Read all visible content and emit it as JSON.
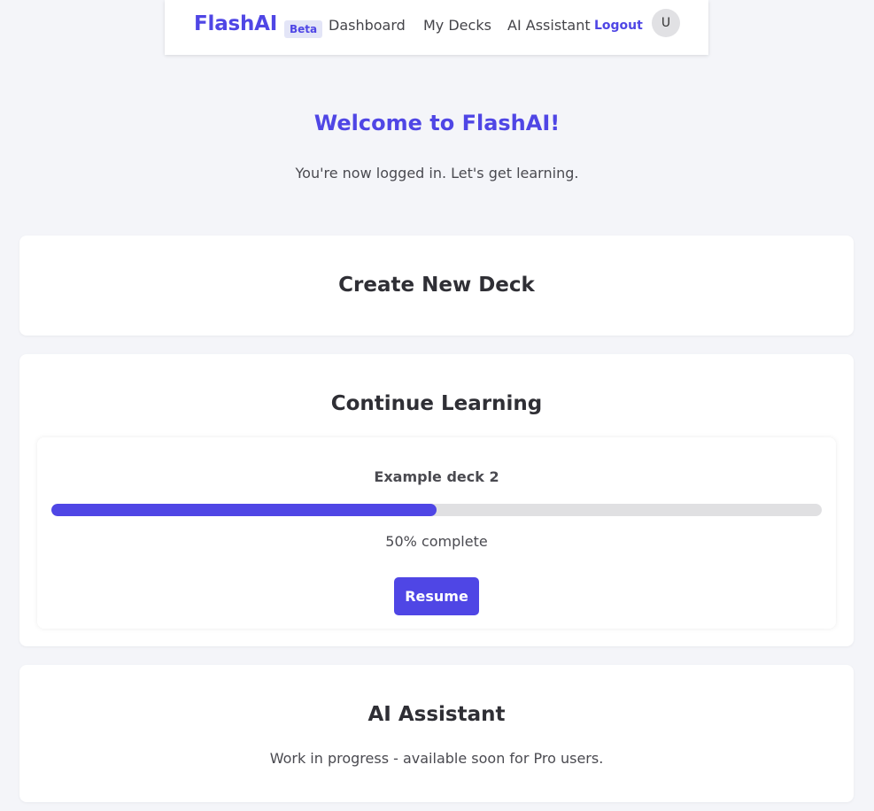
{
  "nav": {
    "brand": "FlashAI",
    "badge": "Beta",
    "links": [
      "Dashboard",
      "My Decks",
      "AI Assistant"
    ],
    "logout": "Logout",
    "avatar_initial": "U"
  },
  "hero": {
    "title": "Welcome to FlashAI!",
    "subtitle": "You're now logged in. Let's get learning."
  },
  "create_card": {
    "title": "Create New Deck"
  },
  "continue_card": {
    "title": "Continue Learning",
    "deck": {
      "name": "Example deck 2",
      "progress_percent": 50,
      "progress_label": "50% complete",
      "button_label": "Resume"
    }
  },
  "ai_card": {
    "title": "AI Assistant",
    "description": "Work in progress - available soon for Pro users."
  },
  "colors": {
    "accent": "#4f46e5",
    "background": "#f4f5f9",
    "track": "#e0e0e2"
  }
}
